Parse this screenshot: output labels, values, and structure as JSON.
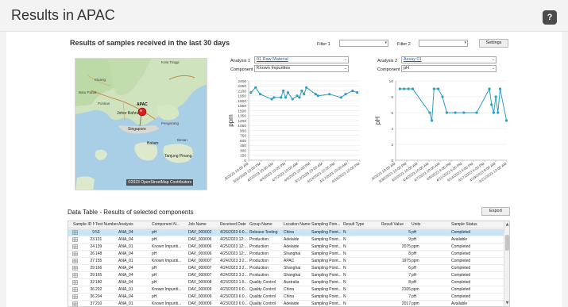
{
  "page": {
    "title": "Results in APAC",
    "help_label": "?"
  },
  "results_panel": {
    "heading": "Results of samples received in the last 30 days",
    "filter1_label": "Filter 1",
    "filter2_label": "Filter 2",
    "filter1_value": "",
    "filter2_value": "",
    "settings_label": "Settings"
  },
  "map": {
    "attribution": "©2023 OpenStreetMap Contributors",
    "labels": [
      "Kluang",
      "Batu Pahat",
      "Kota Tinggi",
      "APAC",
      "Pontian",
      "Johor Bahru",
      "Pengerang",
      "Singapore",
      "Batam",
      "Bintan",
      "Tanjung Pinang",
      "Pulau Bintan",
      "Tanjung Pinang",
      "Palau Batam"
    ]
  },
  "analysis1": {
    "label": "Analysis 1",
    "value": "01 Raw Material",
    "component_label": "Component",
    "component_value": "Known Impurities"
  },
  "analysis2": {
    "label": "Analysis 2",
    "value": "Assay 01",
    "component_label": "Component",
    "component_value": "pH"
  },
  "chart_data": [
    {
      "type": "line",
      "ylabel": "ppm",
      "ylim": [
        0,
        2400
      ],
      "yticks": [
        0,
        150,
        300,
        450,
        600,
        750,
        900,
        1050,
        1200,
        1350,
        1500,
        1650,
        1800,
        1950,
        2100,
        2250,
        2400
      ],
      "xlim": [
        "2023-03-28T10:00",
        "2023-04-21T12:00"
      ],
      "xtick_labels": [
        "3/28/2023 10:00 AM",
        "3/30/2023 10:00 PM",
        "4/2/2023 10:00 AM",
        "4/4/2023 10:00 PM",
        "4/7/2023 10:00 AM",
        "4/9/2023 10:00 PM",
        "4/12/2023 10:00 AM",
        "4/14/2023 10:00 PM",
        "4/17/2023 10:00 AM",
        "4/19/2023 10:00 PM"
      ],
      "grid": true,
      "color": "#2a9fc4",
      "x": [
        "2023-03-28T22:00",
        "2023-03-29T22:00",
        "2023-03-30T22:00",
        "2023-04-02T10:00",
        "2023-04-02T22:00",
        "2023-04-04T10:00",
        "2023-04-04T22:00",
        "2023-04-05T10:00",
        "2023-04-05T22:00",
        "2023-04-06T22:00",
        "2023-04-07T22:00",
        "2023-04-08T10:00",
        "2023-04-08T22:00",
        "2023-04-09T10:00",
        "2023-04-09T22:00",
        "2023-04-11T22:00",
        "2023-04-12T10:00",
        "2023-04-14T22:00",
        "2023-04-17T10:00",
        "2023-04-18T10:00",
        "2023-04-19T22:00",
        "2023-04-20T22:00"
      ],
      "y": [
        2050,
        2200,
        2000,
        1850,
        1900,
        1900,
        2100,
        1900,
        2050,
        1850,
        1950,
        1900,
        2100,
        2000,
        2200,
        2000,
        1950,
        2000,
        1900,
        2000,
        2100,
        2050
      ]
    },
    {
      "type": "line",
      "ylabel": "pH",
      "ylim": [
        0,
        10
      ],
      "yticks": [
        0,
        2,
        4,
        6,
        8,
        10
      ],
      "xlim": [
        "2023-03-26T10:00",
        "2023-04-21T12:00"
      ],
      "xtick_labels": [
        "3/26/2023 10:00 AM",
        "3/30/2023 10:00 PM",
        "4/2/2023 10:00 AM",
        "4/4/2023 10:00 AM",
        "4/7/2023 10:00 AM",
        "4/9/2023 4:00 PM",
        "4/11/2023 4:00 PM",
        "4/14/2023 4:00 PM",
        "4/17/2023 4:00 PM",
        "4/19/2023 8:00 AM",
        "4/21/2023 12:00 AM"
      ],
      "grid": true,
      "color": "#2a9fc4",
      "x": [
        "2023-03-27T10:00",
        "2023-03-28T10:00",
        "2023-03-29T10:00",
        "2023-03-30T10:00",
        "2023-04-03T10:00",
        "2023-04-03T22:00",
        "2023-04-04T10:00",
        "2023-04-05T10:00",
        "2023-04-06T10:00",
        "2023-04-07T10:00",
        "2023-04-09T10:00",
        "2023-04-11T10:00",
        "2023-04-14T10:00",
        "2023-04-17T10:00",
        "2023-04-17T22:00",
        "2023-04-18T10:00",
        "2023-04-18T22:00",
        "2023-04-19T10:00",
        "2023-04-19T22:00",
        "2023-04-21T10:00"
      ],
      "y": [
        9,
        9,
        9,
        9,
        6,
        5,
        9,
        9,
        8,
        6,
        6,
        6,
        6,
        9,
        7,
        6,
        8,
        6,
        9,
        5
      ]
    }
  ],
  "data_table": {
    "title": "Data Table - Results of selected components",
    "export_label": "Export",
    "columns": [
      "Sample ID Nu...",
      "Test Number",
      "Analysis",
      "Component N...",
      "Job Name",
      "Received Date",
      "Group Name",
      "Location Name",
      "Sampling Poin...",
      "Result Type",
      "Result Value",
      "Units",
      "Sample Status"
    ],
    "rows": [
      [
        "9",
        "53",
        "ANA_04",
        "pH",
        "DAV_000002",
        "4/26/2023 6:0...",
        "Release Testing",
        "China",
        "Sampling Point...",
        "N",
        "5",
        "pH",
        "Completed"
      ],
      [
        "23",
        "131",
        "ANA_04",
        "pH",
        "DAV_000006",
        "4/25/2023 12:...",
        "Production",
        "Adelaide",
        "Sampling Point...",
        "N",
        "9",
        "pH",
        "Available"
      ],
      [
        "24",
        "139",
        "ANA_01",
        "Known Impuriti...",
        "DAV_000006",
        "4/25/2023 12:...",
        "Production",
        "Adelaide",
        "Sampling Point...",
        "N",
        "2075",
        "ppm",
        "Completed"
      ],
      [
        "26",
        "148",
        "ANA_04",
        "pH",
        "DAV_000006",
        "4/25/2023 12:...",
        "Production",
        "Shanghai",
        "Sampling Point...",
        "N",
        "8",
        "pH",
        "Completed"
      ],
      [
        "27",
        "155",
        "ANA_01",
        "Known Impuriti...",
        "DAV_000007",
        "4/24/2023 3:2...",
        "Production",
        "APAC",
        "Sampling Point...",
        "N",
        "1975",
        "ppm",
        "Completed"
      ],
      [
        "29",
        "166",
        "ANA_04",
        "pH",
        "DAV_000007",
        "4/24/2023 3:2...",
        "Production",
        "Shanghai",
        "Sampling Point...",
        "N",
        "6",
        "pH",
        "Completed"
      ],
      [
        "29",
        "165",
        "ANA_04",
        "pH",
        "DAV_000007",
        "4/24/2023 3:2...",
        "Production",
        "Shanghai",
        "Sampling Point...",
        "N",
        "7",
        "pH",
        "Completed"
      ],
      [
        "32",
        "180",
        "ANA_04",
        "pH",
        "DAV_000008",
        "4/23/2023 1:5...",
        "Quality Control",
        "Australia",
        "Sampling Point...",
        "N",
        "8",
        "pH",
        "Completed"
      ],
      [
        "36",
        "202",
        "ANA_01",
        "Known Impuriti...",
        "DAV_000009",
        "4/23/2023 6:0...",
        "Quality Control",
        "China",
        "Sampling Point...",
        "N",
        "2105",
        "ppm",
        "Completed"
      ],
      [
        "36",
        "204",
        "ANA_04",
        "pH",
        "DAV_000009",
        "4/23/2023 6:0...",
        "Quality Control",
        "China",
        "Sampling Point...",
        "N",
        "7",
        "pH",
        "Completed"
      ],
      [
        "37",
        "210",
        "ANA_01",
        "Known Impuriti...",
        "DAV_000009",
        "4/23/2023 6:0...",
        "Quality Control",
        "Adelaide",
        "Sampling Point...",
        "N",
        "2017",
        "ppm",
        "Available"
      ]
    ]
  }
}
